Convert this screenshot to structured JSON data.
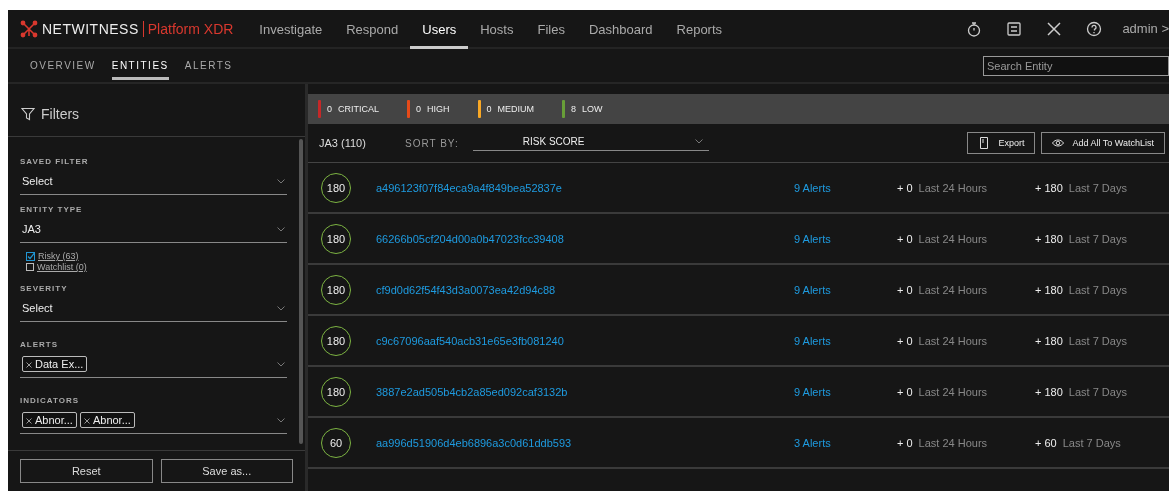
{
  "brand": {
    "name": "NETWITNESS",
    "product": "Platform XDR"
  },
  "nav": [
    {
      "label": "Investigate",
      "selected": false
    },
    {
      "label": "Respond",
      "selected": false
    },
    {
      "label": "Users",
      "selected": true
    },
    {
      "label": "Hosts",
      "selected": false
    },
    {
      "label": "Files",
      "selected": false
    },
    {
      "label": "Dashboard",
      "selected": false
    },
    {
      "label": "Reports",
      "selected": false
    }
  ],
  "user": "admin >",
  "subtabs": [
    {
      "label": "OVERVIEW",
      "selected": false
    },
    {
      "label": "ENTITIES",
      "selected": true
    },
    {
      "label": "ALERTS",
      "selected": false
    }
  ],
  "search": {
    "placeholder": "Search Entity"
  },
  "filters": {
    "title": "Filters",
    "saved_filter": {
      "label": "SAVED FILTER",
      "value": "Select"
    },
    "entity_type": {
      "label": "ENTITY TYPE",
      "value": "JA3"
    },
    "checkboxes": [
      {
        "label": "Risky (63)",
        "checked": true
      },
      {
        "label": "Watchlist (0)",
        "checked": false
      }
    ],
    "severity": {
      "label": "SEVERITY",
      "value": "Select"
    },
    "alerts": {
      "label": "ALERTS",
      "tags": [
        "Data Ex..."
      ]
    },
    "indicators": {
      "label": "INDICATORS",
      "tags": [
        "Abnor...",
        "Abnor..."
      ]
    },
    "buttons": [
      "Reset",
      "Save as..."
    ]
  },
  "severity_counts": [
    {
      "count": "0",
      "label": "CRITICAL",
      "color": "#c62828"
    },
    {
      "count": "0",
      "label": "HIGH",
      "color": "#e64a19"
    },
    {
      "count": "0",
      "label": "MEDIUM",
      "color": "#f9a825"
    },
    {
      "count": "8",
      "label": "LOW",
      "color": "#689f38"
    }
  ],
  "list_header": {
    "title": "JA3 (110)",
    "sort_label": "SORT BY:",
    "sort_value": "RISK SCORE",
    "buttons": [
      {
        "label": "Export",
        "kind": "export"
      },
      {
        "label": "Add All To WatchList",
        "kind": "watch"
      }
    ]
  },
  "entities": [
    {
      "score": "180",
      "name": "a496123f07f84eca9a4f849bea52837e",
      "alerts": "9 Alerts",
      "day_delta": "+ 0",
      "day_label": "Last 24 Hours",
      "week_delta": "+ 180",
      "week_label": "Last 7 Days"
    },
    {
      "score": "180",
      "name": "66266b05cf204d00a0b47023fcc39408",
      "alerts": "9 Alerts",
      "day_delta": "+ 0",
      "day_label": "Last 24 Hours",
      "week_delta": "+ 180",
      "week_label": "Last 7 Days"
    },
    {
      "score": "180",
      "name": "cf9d0d62f54f43d3a0073ea42d94c88",
      "alerts": "9 Alerts",
      "day_delta": "+ 0",
      "day_label": "Last 24 Hours",
      "week_delta": "+ 180",
      "week_label": "Last 7 Days"
    },
    {
      "score": "180",
      "name": "c9c67096aaf540acb31e65e3fb081240",
      "alerts": "9 Alerts",
      "day_delta": "+ 0",
      "day_label": "Last 24 Hours",
      "week_delta": "+ 180",
      "week_label": "Last 7 Days"
    },
    {
      "score": "180",
      "name": "3887e2ad505b4cb2a85ed092caf3132b",
      "alerts": "9 Alerts",
      "day_delta": "+ 0",
      "day_label": "Last 24 Hours",
      "week_delta": "+ 180",
      "week_label": "Last 7 Days"
    },
    {
      "score": "60",
      "name": "aa996d51906d4eb6896a3c0d61ddb593",
      "alerts": "3 Alerts",
      "day_delta": "+ 0",
      "day_label": "Last 24 Hours",
      "week_delta": "+ 60",
      "week_label": "Last 7 Days"
    }
  ]
}
